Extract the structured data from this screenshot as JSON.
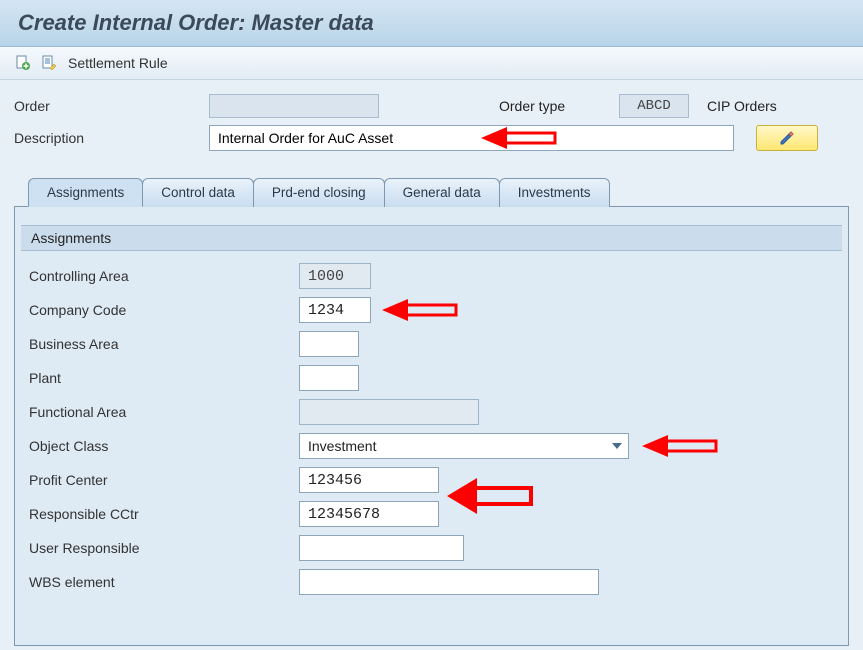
{
  "title": "Create Internal Order: Master data",
  "toolbar": {
    "settlement_rule": "Settlement Rule"
  },
  "header": {
    "order_label": "Order",
    "order_value": "",
    "order_type_label": "Order type",
    "order_type_value": "ABCD",
    "cip_label": "CIP Orders",
    "desc_label": "Description",
    "desc_value": "Internal Order for AuC Asset"
  },
  "tabs": [
    {
      "label": "Assignments"
    },
    {
      "label": "Control data"
    },
    {
      "label": "Prd-end closing"
    },
    {
      "label": "General data"
    },
    {
      "label": "Investments"
    }
  ],
  "assignments": {
    "group_title": "Assignments",
    "controlling_area": {
      "label": "Controlling Area",
      "value": "1000"
    },
    "company_code": {
      "label": "Company Code",
      "value": "1234"
    },
    "business_area": {
      "label": "Business Area",
      "value": ""
    },
    "plant": {
      "label": "Plant",
      "value": ""
    },
    "functional_area": {
      "label": "Functional Area",
      "value": ""
    },
    "object_class": {
      "label": "Object Class",
      "value": "Investment"
    },
    "profit_center": {
      "label": "Profit Center",
      "value": "123456"
    },
    "responsible_cctr": {
      "label": "Responsible CCtr",
      "value": "12345678"
    },
    "user_responsible": {
      "label": "User Responsible",
      "value": ""
    },
    "wbs_element": {
      "label": "WBS element",
      "value": ""
    }
  },
  "annotations": {
    "arrows": [
      {
        "target": "description-input"
      },
      {
        "target": "company-code-input"
      },
      {
        "target": "object-class-dropdown"
      },
      {
        "target": "profit-center-and-cctr"
      }
    ]
  }
}
